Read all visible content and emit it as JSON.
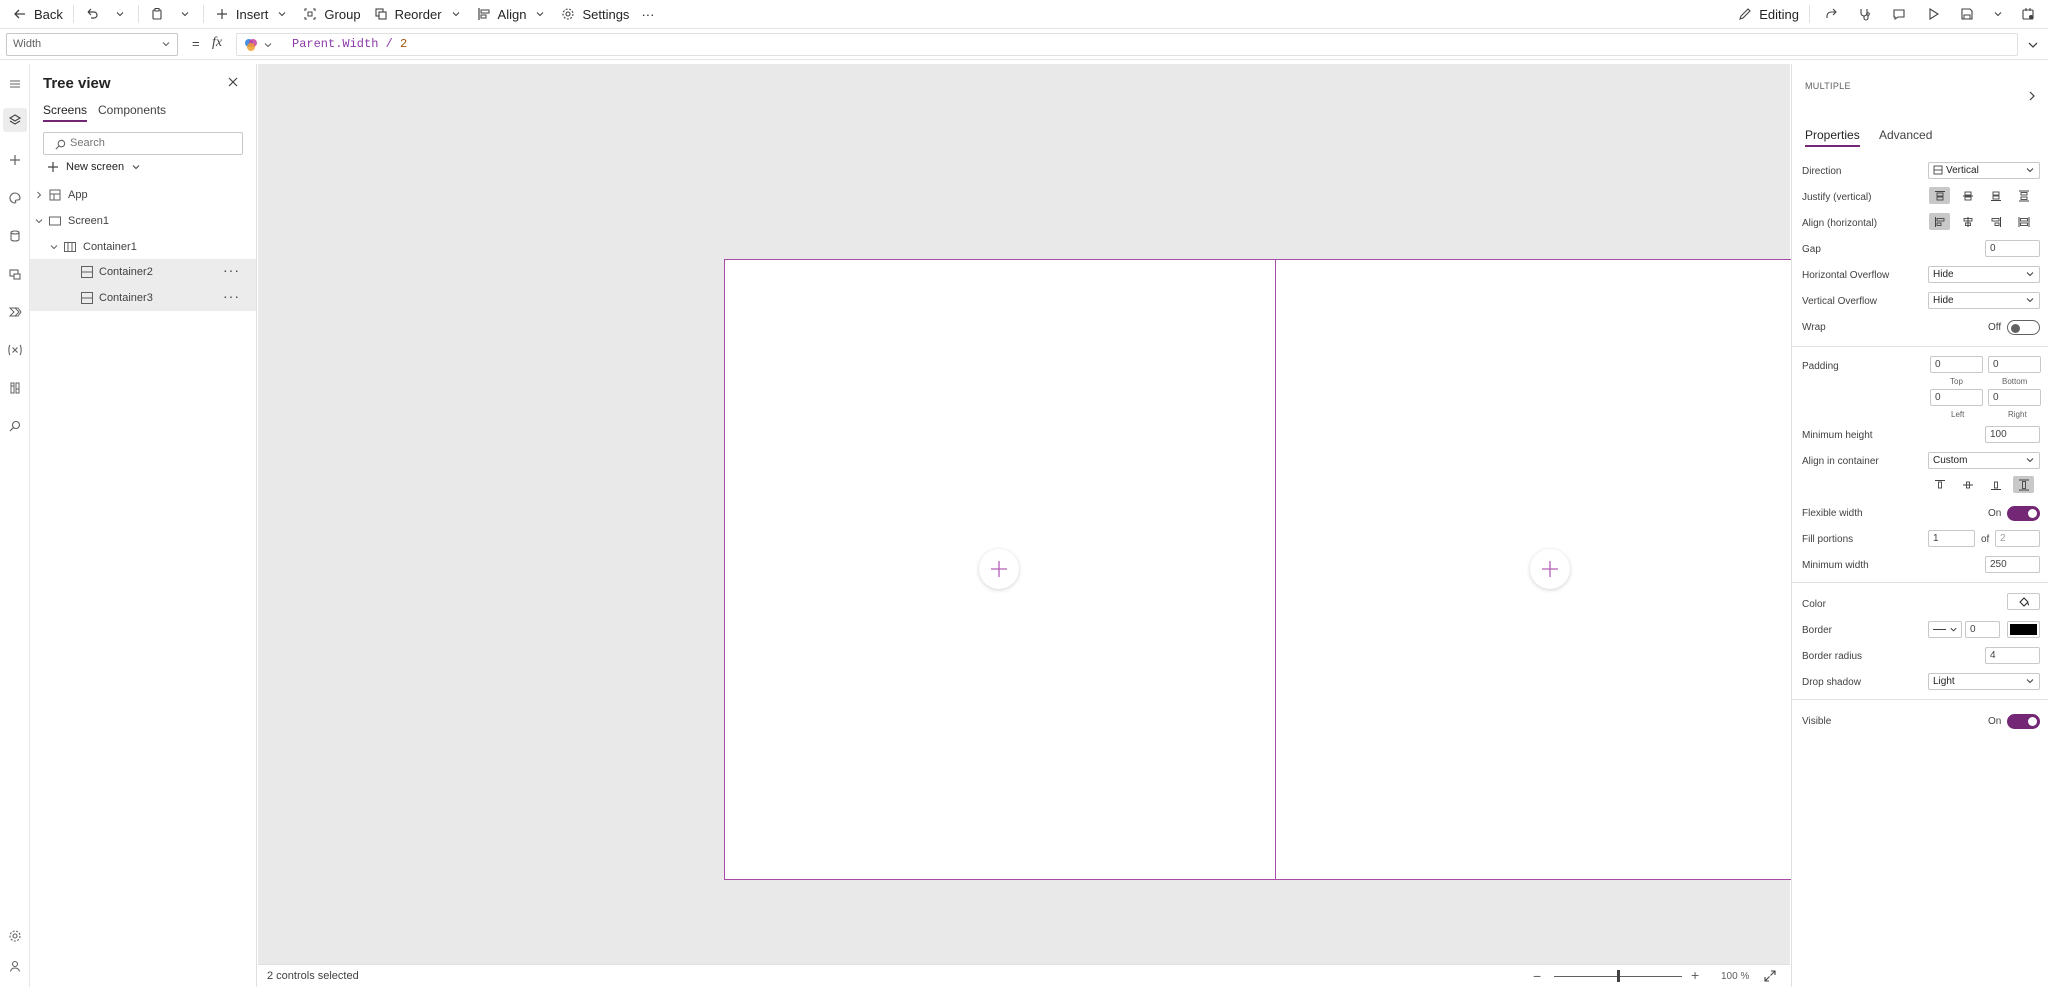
{
  "toolbar": {
    "back": "Back",
    "insert": "Insert",
    "group": "Group",
    "reorder": "Reorder",
    "align": "Align",
    "settings": "Settings",
    "more": "···",
    "editing": "Editing"
  },
  "formula_bar": {
    "property": "Width",
    "equals": "=",
    "fx": "fx",
    "formula_code": "Parent.Width / ",
    "formula_number": "2"
  },
  "tree": {
    "title": "Tree view",
    "tabs": [
      "Screens",
      "Components"
    ],
    "search_placeholder": "Search",
    "new_screen": "New screen",
    "nodes": [
      "App",
      "Screen1",
      "Container1",
      "Container2",
      "Container3"
    ],
    "more": "···"
  },
  "canvas": {
    "status": "2 controls selected",
    "zoom_minus": "−",
    "zoom_plus": "+",
    "zoom_value": "100 %"
  },
  "properties": {
    "header": "MULTIPLE",
    "tabs": [
      "Properties",
      "Advanced"
    ],
    "direction": {
      "label": "Direction",
      "value": "Vertical"
    },
    "justify_label": "Justify (vertical)",
    "align_label": "Align (horizontal)",
    "gap": {
      "label": "Gap",
      "value": "0"
    },
    "horizontal_overflow": {
      "label": "Horizontal Overflow",
      "value": "Hide"
    },
    "vertical_overflow": {
      "label": "Vertical Overflow",
      "value": "Hide"
    },
    "wrap": {
      "label": "Wrap",
      "state": "Off"
    },
    "padding": {
      "label": "Padding",
      "top": "0",
      "bottom": "0",
      "left": "0",
      "right": "0",
      "top_label": "Top",
      "bottom_label": "Bottom",
      "left_label": "Left",
      "right_label": "Right"
    },
    "min_height": {
      "label": "Minimum height",
      "value": "100"
    },
    "align_in_container": {
      "label": "Align in container",
      "value": "Custom"
    },
    "flexible_width": {
      "label": "Flexible width",
      "state": "On"
    },
    "fill_portions": {
      "label": "Fill portions",
      "value": "1",
      "of": "of",
      "total": "2"
    },
    "min_width": {
      "label": "Minimum width",
      "value": "250"
    },
    "color": {
      "label": "Color"
    },
    "border": {
      "label": "Border",
      "value": "0",
      "color": "#000000"
    },
    "border_radius": {
      "label": "Border radius",
      "value": "4"
    },
    "drop_shadow": {
      "label": "Drop shadow",
      "value": "Light"
    },
    "visible": {
      "label": "Visible",
      "state": "On"
    }
  },
  "colors": {
    "accent": "#742774",
    "selection": "#a64ca6",
    "canvas_bg": "#e9e9e9"
  }
}
